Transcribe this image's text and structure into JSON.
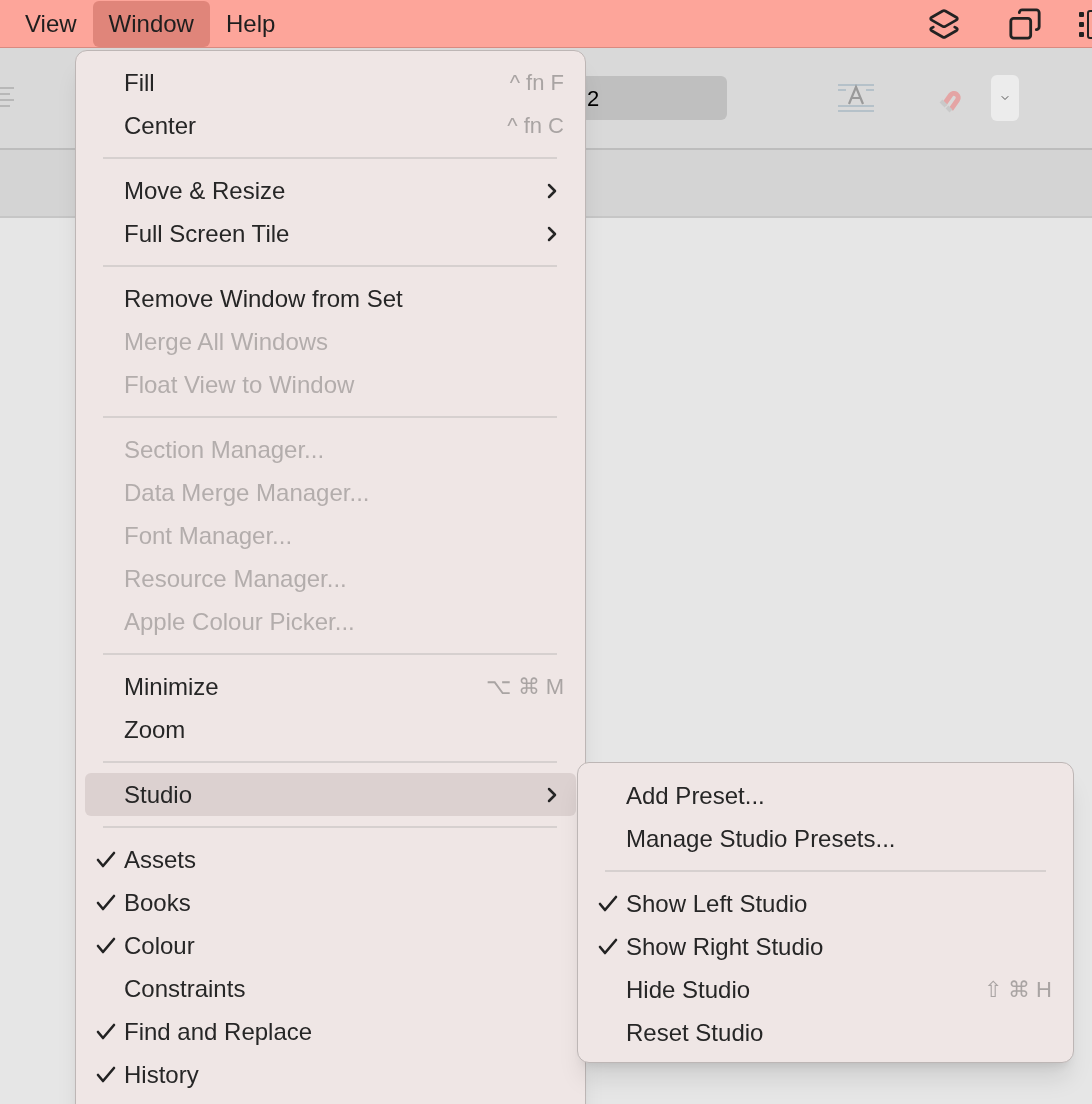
{
  "menubar": {
    "items": [
      {
        "label": "View",
        "selected": false
      },
      {
        "label": "Window",
        "selected": true
      },
      {
        "label": "Help",
        "selected": false
      }
    ]
  },
  "toolbar": {
    "field_value": "2"
  },
  "menu": {
    "items": [
      {
        "kind": "item",
        "label": "Fill",
        "shortcut": "^ fn F",
        "disabled": false
      },
      {
        "kind": "item",
        "label": "Center",
        "shortcut": "^ fn C",
        "disabled": false
      },
      {
        "kind": "separator"
      },
      {
        "kind": "item",
        "label": "Move & Resize",
        "submenu": true,
        "disabled": false
      },
      {
        "kind": "item",
        "label": "Full Screen Tile",
        "submenu": true,
        "disabled": false
      },
      {
        "kind": "separator"
      },
      {
        "kind": "item",
        "label": "Remove Window from Set",
        "disabled": false
      },
      {
        "kind": "item",
        "label": "Merge All Windows",
        "disabled": true
      },
      {
        "kind": "item",
        "label": "Float View to Window",
        "disabled": true
      },
      {
        "kind": "separator"
      },
      {
        "kind": "item",
        "label": "Section Manager...",
        "disabled": true
      },
      {
        "kind": "item",
        "label": "Data Merge Manager...",
        "disabled": true
      },
      {
        "kind": "item",
        "label": "Font Manager...",
        "disabled": true
      },
      {
        "kind": "item",
        "label": "Resource Manager...",
        "disabled": true
      },
      {
        "kind": "item",
        "label": "Apple Colour Picker...",
        "disabled": true
      },
      {
        "kind": "separator"
      },
      {
        "kind": "item",
        "label": "Minimize",
        "shortcut": "⌥ ⌘ M",
        "disabled": false
      },
      {
        "kind": "item",
        "label": "Zoom",
        "disabled": false
      },
      {
        "kind": "separator"
      },
      {
        "kind": "item",
        "label": "Studio",
        "submenu": true,
        "selected": true,
        "disabled": false
      },
      {
        "kind": "separator"
      },
      {
        "kind": "item",
        "label": "Assets",
        "checked": true,
        "disabled": false
      },
      {
        "kind": "item",
        "label": "Books",
        "checked": true,
        "disabled": false
      },
      {
        "kind": "item",
        "label": "Colour",
        "checked": true,
        "disabled": false
      },
      {
        "kind": "item",
        "label": "Constraints",
        "checked": false,
        "disabled": false
      },
      {
        "kind": "item",
        "label": "Find and Replace",
        "checked": true,
        "disabled": false
      },
      {
        "kind": "item",
        "label": "History",
        "checked": true,
        "disabled": false
      }
    ]
  },
  "submenu": {
    "items": [
      {
        "kind": "item",
        "label": "Add Preset...",
        "disabled": false
      },
      {
        "kind": "item",
        "label": "Manage Studio Presets...",
        "disabled": false
      },
      {
        "kind": "separator"
      },
      {
        "kind": "item",
        "label": "Show Left Studio",
        "checked": true,
        "disabled": false
      },
      {
        "kind": "item",
        "label": "Show Right Studio",
        "checked": true,
        "disabled": false
      },
      {
        "kind": "item",
        "label": "Hide Studio",
        "shortcut": "⇧ ⌘ H",
        "checked": false,
        "disabled": false
      },
      {
        "kind": "item",
        "label": "Reset Studio",
        "checked": false,
        "disabled": false
      }
    ]
  }
}
